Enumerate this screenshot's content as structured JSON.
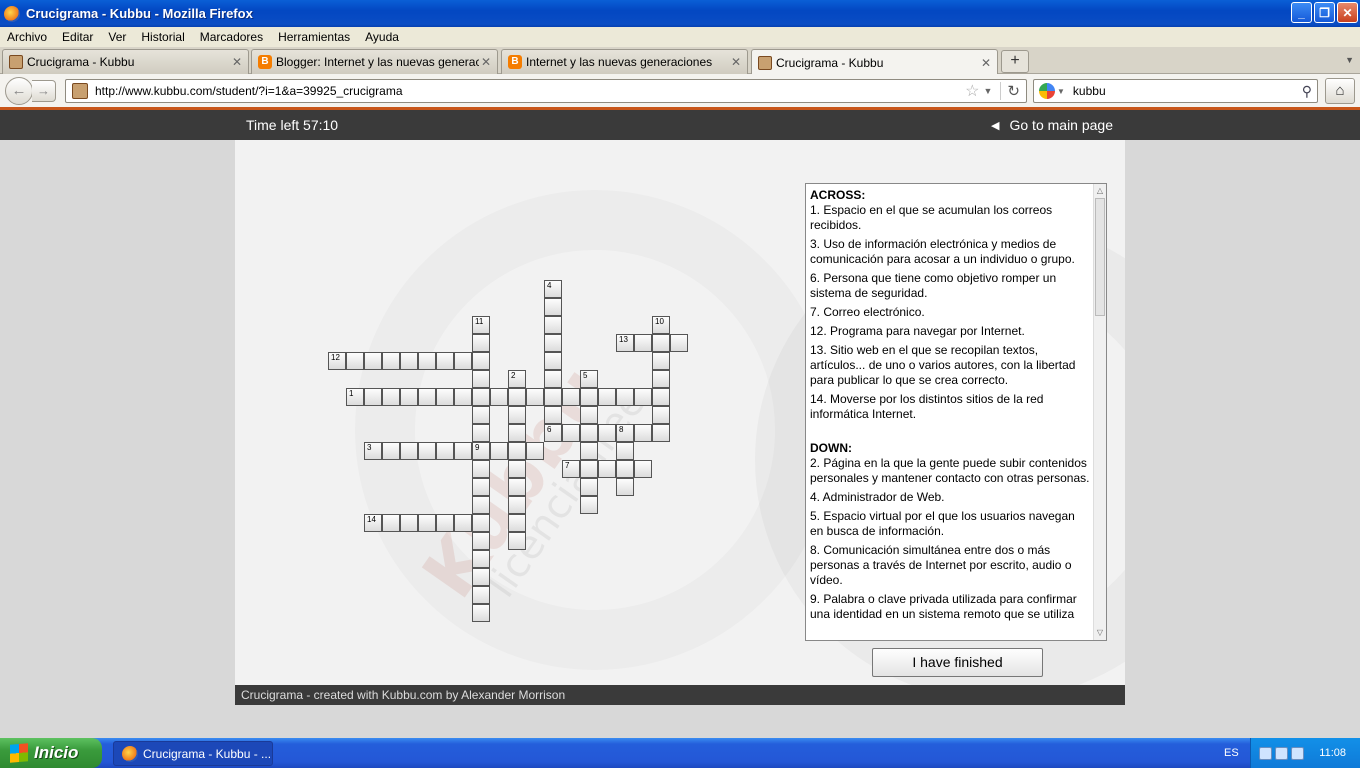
{
  "window": {
    "title": "Crucigrama - Kubbu - Mozilla Firefox"
  },
  "menu": [
    "Archivo",
    "Editar",
    "Ver",
    "Historial",
    "Marcadores",
    "Herramientas",
    "Ayuda"
  ],
  "tabs": [
    {
      "label": "Crucigrama - Kubbu",
      "icon": "kubbu-icon"
    },
    {
      "label": "Blogger: Internet y las nuevas generacio...",
      "icon": "blogger-icon"
    },
    {
      "label": "Internet y las nuevas generaciones",
      "icon": "blogger-icon"
    },
    {
      "label": "Crucigrama - Kubbu",
      "icon": "kubbu-icon",
      "active": true
    }
  ],
  "nav": {
    "url": "http://www.kubbu.com/student/?i=1&a=39925_crucigrama",
    "search": "kubbu"
  },
  "page": {
    "time_left": "Time left 57:10",
    "main_link": "Go to main page",
    "finish_button": "I have finished",
    "footer": "Crucigrama - created with Kubbu.com by Alexander Morrison",
    "watermark": "Kubbu",
    "watermark_sub": "licencia free"
  },
  "clues": {
    "across_title": "ACROSS:",
    "across": [
      "1. Espacio en el que se acumulan los correos recibidos.",
      "3. Uso de información electrónica y medios de comunicación para acosar a un individuo o grupo.",
      "6. Persona que tiene como objetivo romper un sistema de seguridad.",
      "7. Correo electrónico.",
      "12. Programa para navegar por Internet.",
      "13. Sitio web en el que se recopilan textos, artículos... de uno o varios autores, con la libertad para publicar lo que se crea correcto.",
      "14. Moverse por los distintos sitios de la red informática Internet."
    ],
    "down_title": "DOWN:",
    "down": [
      "2. Página en la que la gente puede subir contenidos personales y mantener contacto con otras personas.",
      "4. Administrador de Web.",
      "5. Espacio virtual por el que los usuarios navegan en busca de información.",
      "8. Comunicación simultánea entre dos o más personas a través de Internet por escrito, audio o vídeo.",
      "9. Palabra o clave privada utilizada para confirmar una identidad en un sistema remoto que se utiliza"
    ]
  },
  "crossword": {
    "entries": [
      {
        "num": "1",
        "dir": "across",
        "row": 7,
        "col": 1,
        "len": 18
      },
      {
        "num": "3",
        "dir": "across",
        "row": 10,
        "col": 2,
        "len": 10
      },
      {
        "num": "6",
        "dir": "across",
        "row": 9,
        "col": 12,
        "len": 7
      },
      {
        "num": "7",
        "dir": "across",
        "row": 11,
        "col": 13,
        "len": 5
      },
      {
        "num": "12",
        "dir": "across",
        "row": 5,
        "col": 0,
        "len": 9
      },
      {
        "num": "13",
        "dir": "across",
        "row": 4,
        "col": 16,
        "len": 4
      },
      {
        "num": "14",
        "dir": "across",
        "row": 14,
        "col": 2,
        "len": 7
      },
      {
        "num": "2",
        "dir": "down",
        "row": 6,
        "col": 10,
        "len": 10
      },
      {
        "num": "4",
        "dir": "down",
        "row": 1,
        "col": 12,
        "len": 9
      },
      {
        "num": "5",
        "dir": "down",
        "row": 6,
        "col": 14,
        "len": 8
      },
      {
        "num": "8",
        "dir": "down",
        "row": 9,
        "col": 16,
        "len": 4
      },
      {
        "num": "9",
        "dir": "down",
        "row": 10,
        "col": 8,
        "len": 10
      },
      {
        "num": "10",
        "dir": "down",
        "row": 3,
        "col": 18,
        "len": 7
      },
      {
        "num": "11",
        "dir": "down",
        "row": 3,
        "col": 8,
        "len": 7
      }
    ]
  },
  "taskbar": {
    "start": "Inicio",
    "task": "Crucigrama - Kubbu - ...",
    "lang": "ES",
    "clock": "11:08"
  }
}
